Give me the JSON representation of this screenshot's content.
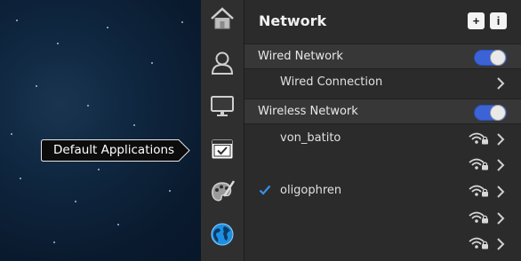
{
  "tooltip": {
    "label": "Default Applications"
  },
  "dock": {
    "items": [
      {
        "icon": "home-icon"
      },
      {
        "icon": "user-icon"
      },
      {
        "icon": "display-icon"
      },
      {
        "icon": "default-applications-icon"
      },
      {
        "icon": "appearance-icon"
      },
      {
        "icon": "network-globe-icon"
      }
    ]
  },
  "panel": {
    "title": "Network",
    "add_label": "+",
    "info_label": "i",
    "wired": {
      "label": "Wired Network",
      "enabled": true,
      "connection_label": "Wired Connection"
    },
    "wireless": {
      "label": "Wireless Network",
      "enabled": true,
      "networks": [
        {
          "name": "von_batito",
          "connected": false
        },
        {
          "name": "",
          "connected": false
        },
        {
          "name": "oligophren",
          "connected": true
        },
        {
          "name": "",
          "connected": false
        },
        {
          "name": "",
          "connected": false
        }
      ]
    }
  },
  "colors": {
    "accent": "#3b63d6",
    "check": "#3a8ee8",
    "panel_bg": "#2b2b2b",
    "dock_bg": "#2f2f2f"
  }
}
